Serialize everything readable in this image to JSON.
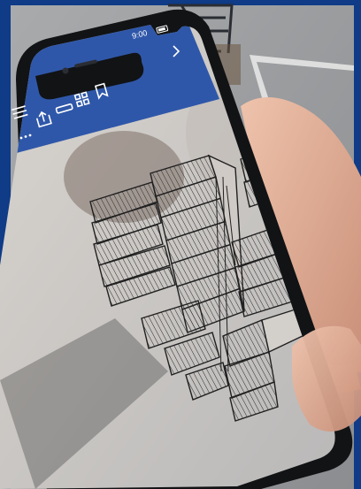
{
  "status_bar": {
    "time": "9:00",
    "carrier": "",
    "signal_icon": "signal-icon",
    "battery_icon": "battery-icon"
  },
  "toolbar": {
    "icons": [
      "list-icon",
      "share-icon",
      "measure-icon",
      "grid-view-icon",
      "bookmark-icon",
      "more-icon",
      "chevron-right-icon"
    ]
  },
  "colors": {
    "frame": "#0f3b87",
    "ground": "#9a9c9f",
    "phone_body": "#111315",
    "app_bar": "#2f57a9",
    "skin": "#e2b39c",
    "model_line": "#202020"
  }
}
